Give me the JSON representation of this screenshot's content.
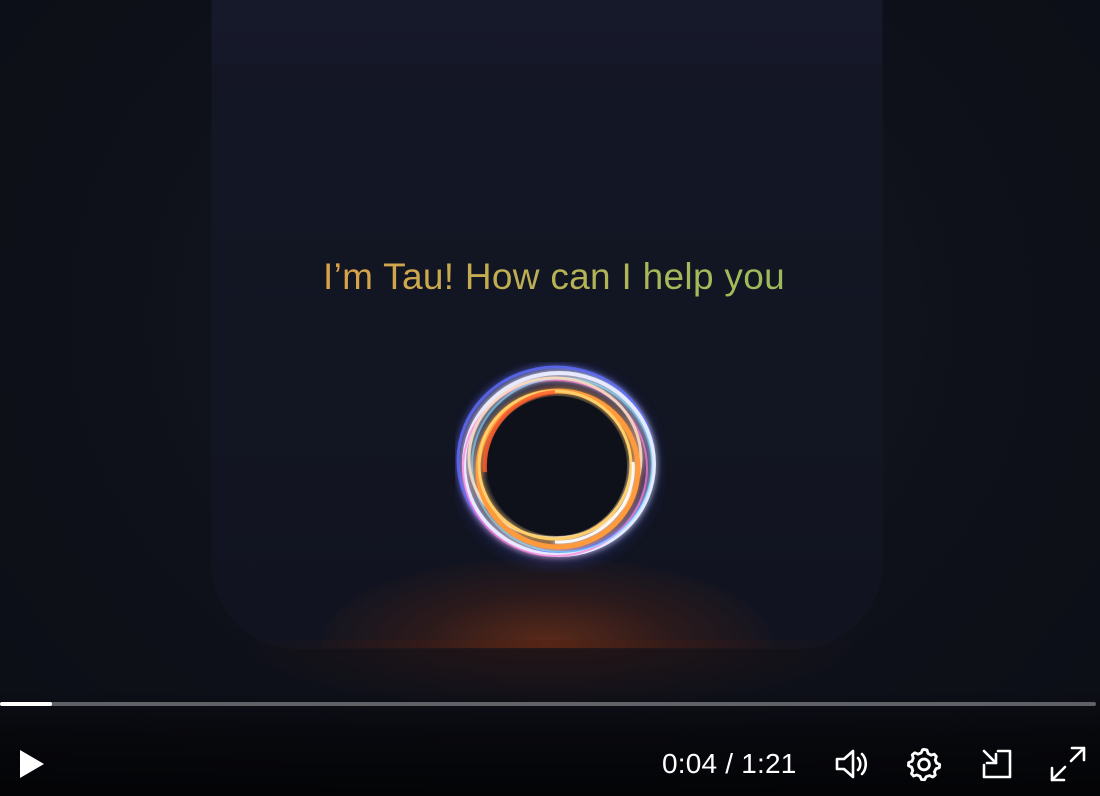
{
  "video": {
    "caption": "I’m Tau! How can I help you"
  },
  "player": {
    "progress_fraction": 0.047,
    "current_time": "0:04",
    "separator": "/",
    "duration": "1:21",
    "icons": {
      "play": "play-icon",
      "volume": "volume-icon",
      "settings": "gear-icon",
      "pip": "picture-in-picture-icon",
      "fullscreen": "fullscreen-icon"
    }
  },
  "colors": {
    "caption_gradient": [
      "#e38a4c",
      "#d9a24a",
      "#a8b85a",
      "#7cc35a"
    ],
    "progress_fill": "#ffffff",
    "progress_track": "#6b6e78"
  }
}
